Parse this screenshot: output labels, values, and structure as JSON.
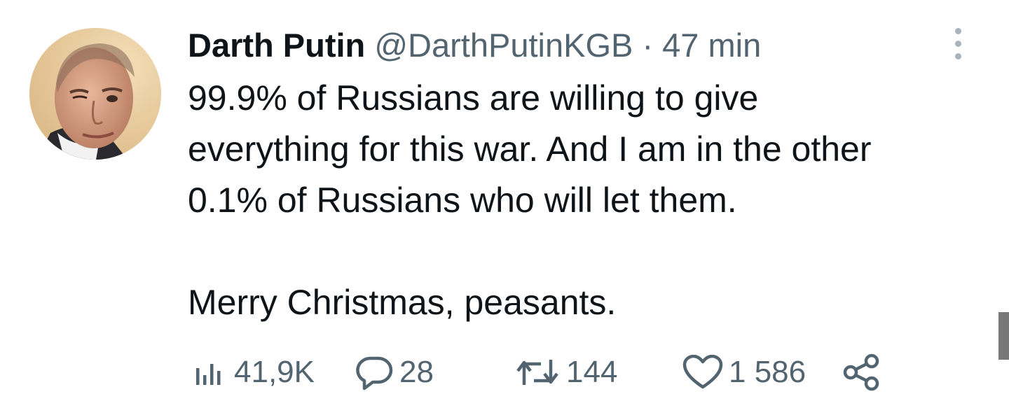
{
  "tweet": {
    "author_name": "Darth Putin",
    "handle": "@DarthPutinKGB",
    "separator": "·",
    "time": "47 min",
    "avatar_icon": "user-avatar-photo",
    "text_lines": [
      "99.9% of Russians are willing to give",
      "everything for this war. And I am in the other",
      "0.1% of Russians who will let them."
    ],
    "text_closing": "Merry Christmas, peasants."
  },
  "stats": {
    "views": "41,9K",
    "replies": "28",
    "retweets": "144",
    "likes": "1 586"
  },
  "icons": {
    "views": "views-bar-chart-icon",
    "reply": "reply-bubble-icon",
    "retweet": "retweet-arrows-icon",
    "like": "heart-icon",
    "share": "share-icon",
    "more": "more-vertical-icon"
  },
  "colors": {
    "text": "#0f1419",
    "secondary": "#536471",
    "more_dots": "#a8b3bb"
  }
}
